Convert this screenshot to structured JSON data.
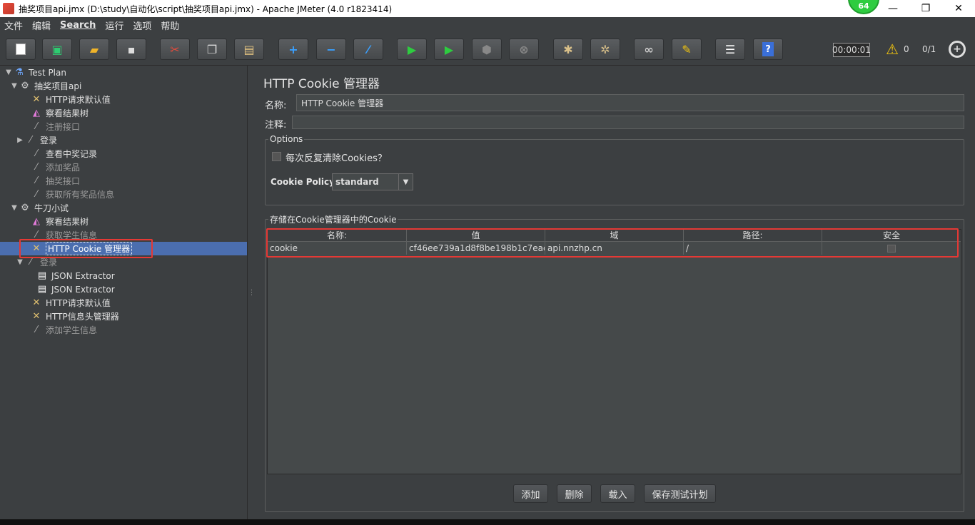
{
  "window": {
    "title": "抽奖项目api.jmx (D:\\study\\自动化\\script\\抽奖项目api.jmx) - Apache JMeter (4.0 r1823414)",
    "badge": "64",
    "minimize": "—",
    "restore": "❐",
    "close": "✕"
  },
  "menu": [
    "文件",
    "编辑",
    "Search",
    "运行",
    "选项",
    "帮助"
  ],
  "toolbar": {
    "timer": "00:00:01",
    "warning_count": "0",
    "threads": "0/1"
  },
  "tree": {
    "nodes": [
      {
        "label": "Test Plan",
        "icon": "flask-icon"
      },
      {
        "label": "抽奖项目api",
        "icon": "gear-icon"
      },
      {
        "label": "HTTP请求默认值",
        "icon": "wrench-icon"
      },
      {
        "label": "察看结果树",
        "icon": "chart-icon"
      },
      {
        "label": "注册接口",
        "icon": "pipette-icon"
      },
      {
        "label": "登录",
        "icon": "pipette-icon"
      },
      {
        "label": "查看中奖记录",
        "icon": "pipette-icon"
      },
      {
        "label": "添加奖品",
        "icon": "pipette-icon"
      },
      {
        "label": "抽奖接口",
        "icon": "pipette-icon"
      },
      {
        "label": "获取所有奖品信息",
        "icon": "pipette-icon"
      },
      {
        "label": "牛刀小试",
        "icon": "gear-icon"
      },
      {
        "label": "察看结果树",
        "icon": "chart-icon"
      },
      {
        "label": "获取学生信息",
        "icon": "pipette-icon"
      },
      {
        "label": "HTTP Cookie 管理器",
        "icon": "wrench-icon"
      },
      {
        "label": "登录",
        "icon": "pipette-icon"
      },
      {
        "label": "JSON Extractor",
        "icon": "document-icon"
      },
      {
        "label": "JSON Extractor",
        "icon": "document-icon"
      },
      {
        "label": "HTTP请求默认值",
        "icon": "wrench-icon"
      },
      {
        "label": "HTTP信息头管理器",
        "icon": "wrench-icon"
      },
      {
        "label": "添加学生信息",
        "icon": "pipette-icon"
      }
    ]
  },
  "panel": {
    "title": "HTTP Cookie 管理器",
    "name_label": "名称:",
    "name_value": "HTTP Cookie 管理器",
    "comment_label": "注释:",
    "comment_value": "",
    "options_legend": "Options",
    "clear_each_iteration": "每次反复清除Cookies？",
    "policy_label": "Cookie Policy:",
    "policy_value": "standard",
    "stored_legend": "存储在Cookie管理器中的Cookie"
  },
  "table": {
    "headers": [
      "名称:",
      "值",
      "域",
      "路径:",
      "安全"
    ],
    "rows": [
      {
        "name": "cookie",
        "value": "cf46ee739a1d8f8be198b1c7eac...",
        "domain": "api.nnzhp.cn",
        "path": "/",
        "secure": false
      }
    ]
  },
  "buttons": {
    "add": "添加",
    "delete": "删除",
    "load": "载入",
    "save": "保存测试计划"
  }
}
